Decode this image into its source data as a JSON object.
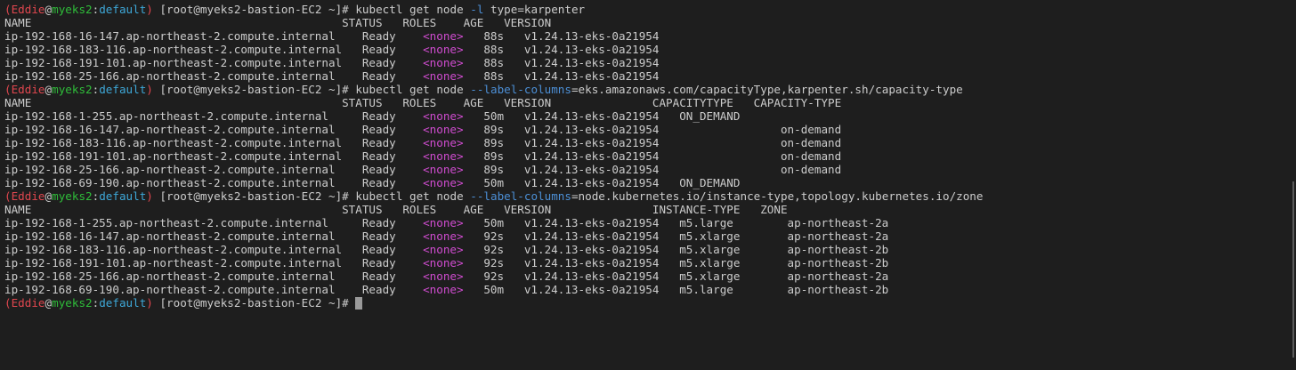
{
  "colors": {
    "background": "#1e1e1e",
    "foreground": "#cccccc",
    "prompt_paren_user": "#e0474f",
    "prompt_host": "#2fbd3a",
    "prompt_namespace": "#3ea8d8",
    "none_role": "#d04cd0",
    "flag": "#4c8fd6",
    "cursor": "#9a9a9a"
  },
  "terminal": {
    "lines": [
      [
        {
          "t": "(",
          "c": "red"
        },
        {
          "t": "Eddie",
          "c": "red"
        },
        {
          "t": "@",
          "c": "white"
        },
        {
          "t": "myeks2",
          "c": "green"
        },
        {
          "t": ":",
          "c": "white"
        },
        {
          "t": "default",
          "c": "cyan"
        },
        {
          "t": ")",
          "c": "red"
        },
        {
          "t": " [root@myeks2-bastion-EC2 ~]# kubectl get node ",
          "c": "white"
        },
        {
          "t": "-l",
          "c": "flag"
        },
        {
          "t": " type=karpenter",
          "c": "white"
        }
      ],
      [
        {
          "t": "NAME                                              STATUS   ROLES    AGE   VERSION",
          "c": "white"
        }
      ],
      [
        {
          "t": "ip-192-168-16-147.ap-northeast-2.compute.internal    Ready    ",
          "c": "white"
        },
        {
          "t": "<none>",
          "c": "magenta"
        },
        {
          "t": "   88s   v1.24.13-eks-0a21954",
          "c": "white"
        }
      ],
      [
        {
          "t": "ip-192-168-183-116.ap-northeast-2.compute.internal   Ready    ",
          "c": "white"
        },
        {
          "t": "<none>",
          "c": "magenta"
        },
        {
          "t": "   88s   v1.24.13-eks-0a21954",
          "c": "white"
        }
      ],
      [
        {
          "t": "ip-192-168-191-101.ap-northeast-2.compute.internal   Ready    ",
          "c": "white"
        },
        {
          "t": "<none>",
          "c": "magenta"
        },
        {
          "t": "   88s   v1.24.13-eks-0a21954",
          "c": "white"
        }
      ],
      [
        {
          "t": "ip-192-168-25-166.ap-northeast-2.compute.internal    Ready    ",
          "c": "white"
        },
        {
          "t": "<none>",
          "c": "magenta"
        },
        {
          "t": "   88s   v1.24.13-eks-0a21954",
          "c": "white"
        }
      ],
      [
        {
          "t": "(",
          "c": "red"
        },
        {
          "t": "Eddie",
          "c": "red"
        },
        {
          "t": "@",
          "c": "white"
        },
        {
          "t": "myeks2",
          "c": "green"
        },
        {
          "t": ":",
          "c": "white"
        },
        {
          "t": "default",
          "c": "cyan"
        },
        {
          "t": ")",
          "c": "red"
        },
        {
          "t": " [root@myeks2-bastion-EC2 ~]# kubectl get node ",
          "c": "white"
        },
        {
          "t": "--label-columns",
          "c": "flag"
        },
        {
          "t": "=eks.amazonaws.com/capacityType,karpenter.sh/capacity-type",
          "c": "white"
        }
      ],
      [
        {
          "t": "NAME                                              STATUS   ROLES    AGE   VERSION               CAPACITYTYPE   CAPACITY-TYPE",
          "c": "white"
        }
      ],
      [
        {
          "t": "ip-192-168-1-255.ap-northeast-2.compute.internal     Ready    ",
          "c": "white"
        },
        {
          "t": "<none>",
          "c": "magenta"
        },
        {
          "t": "   50m   v1.24.13-eks-0a21954   ON_DEMAND",
          "c": "white"
        }
      ],
      [
        {
          "t": "ip-192-168-16-147.ap-northeast-2.compute.internal    Ready    ",
          "c": "white"
        },
        {
          "t": "<none>",
          "c": "magenta"
        },
        {
          "t": "   89s   v1.24.13-eks-0a21954                  on-demand",
          "c": "white"
        }
      ],
      [
        {
          "t": "ip-192-168-183-116.ap-northeast-2.compute.internal   Ready    ",
          "c": "white"
        },
        {
          "t": "<none>",
          "c": "magenta"
        },
        {
          "t": "   89s   v1.24.13-eks-0a21954                  on-demand",
          "c": "white"
        }
      ],
      [
        {
          "t": "ip-192-168-191-101.ap-northeast-2.compute.internal   Ready    ",
          "c": "white"
        },
        {
          "t": "<none>",
          "c": "magenta"
        },
        {
          "t": "   89s   v1.24.13-eks-0a21954                  on-demand",
          "c": "white"
        }
      ],
      [
        {
          "t": "ip-192-168-25-166.ap-northeast-2.compute.internal    Ready    ",
          "c": "white"
        },
        {
          "t": "<none>",
          "c": "magenta"
        },
        {
          "t": "   89s   v1.24.13-eks-0a21954                  on-demand",
          "c": "white"
        }
      ],
      [
        {
          "t": "ip-192-168-69-190.ap-northeast-2.compute.internal    Ready    ",
          "c": "white"
        },
        {
          "t": "<none>",
          "c": "magenta"
        },
        {
          "t": "   50m   v1.24.13-eks-0a21954   ON_DEMAND",
          "c": "white"
        }
      ],
      [
        {
          "t": "(",
          "c": "red"
        },
        {
          "t": "Eddie",
          "c": "red"
        },
        {
          "t": "@",
          "c": "white"
        },
        {
          "t": "myeks2",
          "c": "green"
        },
        {
          "t": ":",
          "c": "white"
        },
        {
          "t": "default",
          "c": "cyan"
        },
        {
          "t": ")",
          "c": "red"
        },
        {
          "t": " [root@myeks2-bastion-EC2 ~]# kubectl get node ",
          "c": "white"
        },
        {
          "t": "--label-columns",
          "c": "flag"
        },
        {
          "t": "=node.kubernetes.io/instance-type,topology.kubernetes.io/zone",
          "c": "white"
        }
      ],
      [
        {
          "t": "NAME                                              STATUS   ROLES    AGE   VERSION               INSTANCE-TYPE   ZONE",
          "c": "white"
        }
      ],
      [
        {
          "t": "ip-192-168-1-255.ap-northeast-2.compute.internal     Ready    ",
          "c": "white"
        },
        {
          "t": "<none>",
          "c": "magenta"
        },
        {
          "t": "   50m   v1.24.13-eks-0a21954   m5.large        ap-northeast-2a",
          "c": "white"
        }
      ],
      [
        {
          "t": "ip-192-168-16-147.ap-northeast-2.compute.internal    Ready    ",
          "c": "white"
        },
        {
          "t": "<none>",
          "c": "magenta"
        },
        {
          "t": "   92s   v1.24.13-eks-0a21954   m5.xlarge       ap-northeast-2a",
          "c": "white"
        }
      ],
      [
        {
          "t": "ip-192-168-183-116.ap-northeast-2.compute.internal   Ready    ",
          "c": "white"
        },
        {
          "t": "<none>",
          "c": "magenta"
        },
        {
          "t": "   92s   v1.24.13-eks-0a21954   m5.xlarge       ap-northeast-2b",
          "c": "white"
        }
      ],
      [
        {
          "t": "ip-192-168-191-101.ap-northeast-2.compute.internal   Ready    ",
          "c": "white"
        },
        {
          "t": "<none>",
          "c": "magenta"
        },
        {
          "t": "   92s   v1.24.13-eks-0a21954   m5.xlarge       ap-northeast-2b",
          "c": "white"
        }
      ],
      [
        {
          "t": "ip-192-168-25-166.ap-northeast-2.compute.internal    Ready    ",
          "c": "white"
        },
        {
          "t": "<none>",
          "c": "magenta"
        },
        {
          "t": "   92s   v1.24.13-eks-0a21954   m5.xlarge       ap-northeast-2a",
          "c": "white"
        }
      ],
      [
        {
          "t": "ip-192-168-69-190.ap-northeast-2.compute.internal    Ready    ",
          "c": "white"
        },
        {
          "t": "<none>",
          "c": "magenta"
        },
        {
          "t": "   50m   v1.24.13-eks-0a21954   m5.large        ap-northeast-2b",
          "c": "white"
        }
      ],
      [
        {
          "t": "(",
          "c": "red"
        },
        {
          "t": "Eddie",
          "c": "red"
        },
        {
          "t": "@",
          "c": "white"
        },
        {
          "t": "myeks2",
          "c": "green"
        },
        {
          "t": ":",
          "c": "white"
        },
        {
          "t": "default",
          "c": "cyan"
        },
        {
          "t": ")",
          "c": "red"
        },
        {
          "t": " [root@myeks2-bastion-EC2 ~]# ",
          "c": "white"
        }
      ]
    ]
  }
}
